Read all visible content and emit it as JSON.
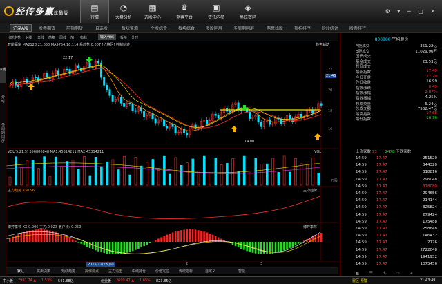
{
  "app": {
    "name": "经传多赢",
    "edition": "炫酷版"
  },
  "nav": [
    {
      "label": "行情",
      "icon": "chart-icon"
    },
    {
      "label": "大盘分析",
      "icon": "pie-icon"
    },
    {
      "label": "选股中心",
      "icon": "grid-icon"
    },
    {
      "label": "至尊平台",
      "icon": "crown-icon"
    },
    {
      "label": "资讯内参",
      "icon": "news-icon"
    },
    {
      "label": "黑位密码",
      "icon": "lock-icon"
    }
  ],
  "menu": [
    "沪深A股",
    "股票期货",
    "前指期货",
    "自选股",
    "板块监测",
    "个股综合",
    "板块综合",
    "多股同屏",
    "多周期同屏",
    "两意比股",
    "指标排序",
    "阶段统计",
    "股票排行"
  ],
  "toolbar": [
    "分时走势",
    "K线",
    "日线",
    "前复",
    "周线",
    "加",
    "指标",
    "板块",
    "分时"
  ],
  "toolbar_search": "输入代码",
  "left_tabs": [
    "K线",
    "分时",
    "多周期同屏",
    "多周期同屏"
  ],
  "chart": {
    "header": "智能赢家 MA2128:21.650  MA9754:16.114  系趋势:0.00T  [价格区] 控制轨迹",
    "header_right": "趋势辅助",
    "high_label": "22.17",
    "low_label": "14.00",
    "date_label": "2015/12/28(四)",
    "price_ticks": [
      "22",
      "20",
      "18",
      "16"
    ],
    "price_marker": "21.46",
    "vol_header": "VOL(5,21,5)  356806848  MA1:45314211  MA2:45314211",
    "vol_right": "VOL",
    "vol_tick": "万股",
    "zl_header": "主力趋势  138.96",
    "zl_right": "主力趋势",
    "bq_header": "博弈季节  XX:0.006  主力:0.023  散户线:-0.059",
    "bq_right": "博弈季节",
    "x_ticks": [
      "2",
      "3"
    ]
  },
  "rightpanel": {
    "code": "800800",
    "title": "平均股价",
    "rows": [
      {
        "k": "A股成交",
        "v": "351.22亿",
        "c": "white"
      },
      {
        "k": "B股成交",
        "v": "11029.96万",
        "c": "white"
      },
      {
        "k": "国债成交",
        "v": "",
        "c": "white"
      },
      {
        "k": "基金成交",
        "v": "23.53亿",
        "c": "white"
      },
      {
        "k": "权证成交",
        "v": "",
        "c": "white"
      },
      {
        "k": "最新指数",
        "v": "17.49",
        "c": "red"
      },
      {
        "k": "今日开盘",
        "v": "17.20",
        "c": "red"
      },
      {
        "k": "昨日收盘",
        "v": "16.99",
        "c": "white"
      },
      {
        "k": "指数涨跌",
        "v": "0.49",
        "c": "red"
      },
      {
        "k": "指数涨幅",
        "v": "2.87%",
        "c": "red"
      },
      {
        "k": "指数振幅",
        "v": "4.25%",
        "c": "white"
      },
      {
        "k": "总成交量",
        "v": "6.24亿",
        "c": "white"
      },
      {
        "k": "总成交额",
        "v": "7532.47亿",
        "c": "white"
      },
      {
        "k": "最高指数",
        "v": "17.68",
        "c": "red"
      },
      {
        "k": "最低指数",
        "v": "16.96",
        "c": "green"
      }
    ],
    "updown": {
      "label": "上涨家数",
      "up": "95",
      "down_label": "下跌家数",
      "down": "2478"
    },
    "ticks": [
      {
        "t": "14:59",
        "p": "17.47",
        "v": "251520",
        "c": "white"
      },
      {
        "t": "14:59",
        "p": "17.47",
        "v": "344320",
        "c": "white"
      },
      {
        "t": "14:59",
        "p": "17.47",
        "v": "318816",
        "c": "white"
      },
      {
        "t": "14:59",
        "p": "17.47",
        "v": "296048",
        "c": "white"
      },
      {
        "t": "14:59",
        "p": "17.47",
        "v": "318080",
        "c": "red"
      },
      {
        "t": "14:59",
        "p": "17.47",
        "v": "294656",
        "c": "white"
      },
      {
        "t": "14:59",
        "p": "17.47",
        "v": "214144",
        "c": "white"
      },
      {
        "t": "14:59",
        "p": "17.47",
        "v": "325824",
        "c": "white"
      },
      {
        "t": "14:59",
        "p": "17.47",
        "v": "279424",
        "c": "white"
      },
      {
        "t": "14:59",
        "p": "17.47",
        "v": "175488",
        "c": "white"
      },
      {
        "t": "14:59",
        "p": "17.47",
        "v": "258848",
        "c": "white"
      },
      {
        "t": "14:59",
        "p": "17.47",
        "v": "146432",
        "c": "white"
      },
      {
        "t": "14:59",
        "p": "17.47",
        "v": "2176",
        "c": "white"
      },
      {
        "t": "14:59",
        "p": "17.47",
        "v": "2722048",
        "c": "white"
      },
      {
        "t": "14:59",
        "p": "17.47",
        "v": "1941952",
        "c": "white"
      },
      {
        "t": "14:59",
        "p": "17.47",
        "v": "1075456",
        "c": "white"
      }
    ]
  },
  "bottomtabs": [
    "默认",
    "买卖决策",
    "短线趋势",
    "操作要点",
    "主力追击",
    "中线持仓",
    "价值定位",
    "传统指标",
    "自定义",
    "",
    "",
    "智能"
  ],
  "status": {
    "left": "中小板",
    "items": [
      {
        "t": "7991.74 ▲",
        "c": "red"
      },
      {
        "t": "1.53%",
        "c": "red"
      },
      {
        "t": "541.88亿",
        "c": "white"
      },
      {
        "t": "创业板",
        "c": "white"
      },
      {
        "t": "2609.47 ▲",
        "c": "red"
      },
      {
        "t": "1.65%",
        "c": "red"
      },
      {
        "t": "823.85亿",
        "c": "white"
      }
    ],
    "right": "雷区-预警",
    "time": "21:43:49"
  },
  "colors": {
    "up": "#ff3030",
    "down": "#00e0ff",
    "accent": "#f0e000"
  }
}
